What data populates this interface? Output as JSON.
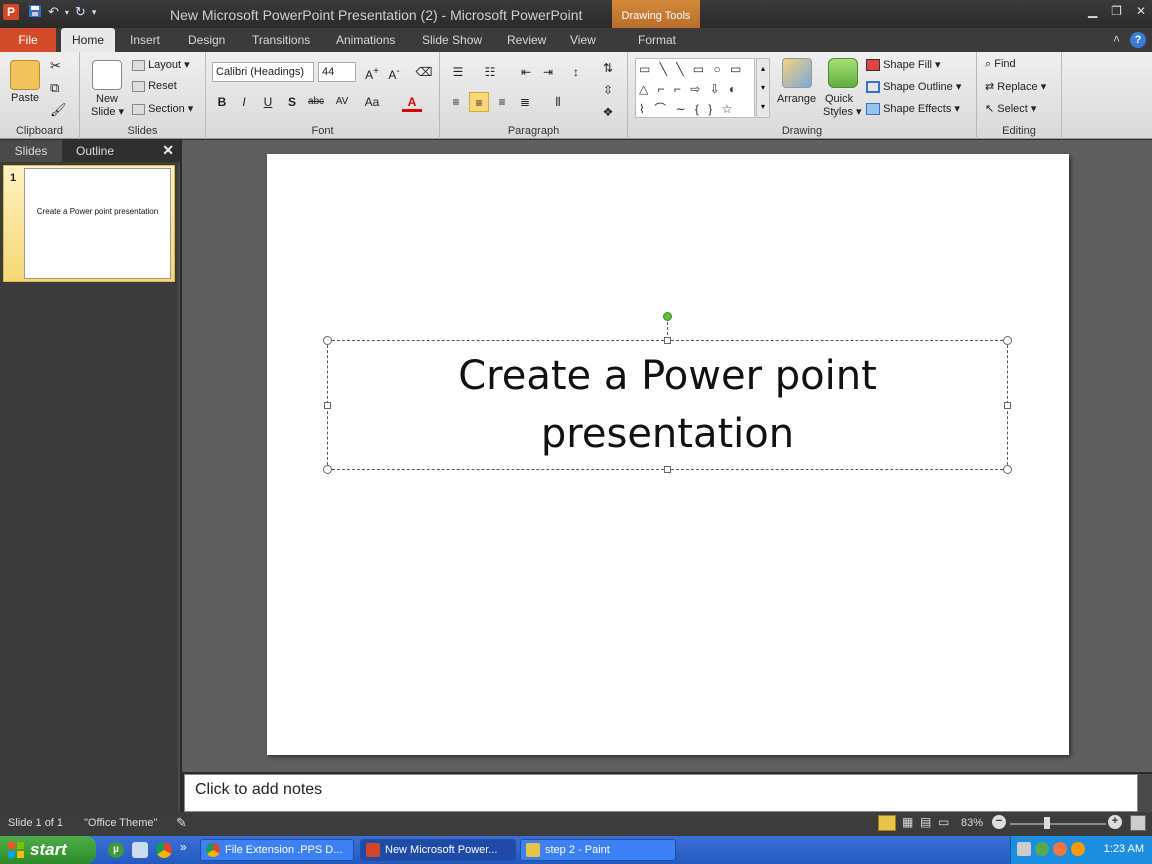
{
  "titlebar": {
    "title": "New Microsoft PowerPoint Presentation (2)  -  Microsoft PowerPoint",
    "contextual_tools": "Drawing Tools",
    "app_icon": "P"
  },
  "tabs": {
    "file": "File",
    "home": "Home",
    "insert": "Insert",
    "design": "Design",
    "transitions": "Transitions",
    "animations": "Animations",
    "slide_show": "Slide Show",
    "review": "Review",
    "view": "View",
    "format": "Format"
  },
  "ribbon": {
    "clipboard": {
      "label": "Clipboard",
      "paste": "Paste"
    },
    "slides": {
      "label": "Slides",
      "new_slide_1": "New",
      "new_slide_2": "Slide ▾",
      "layout": "Layout ▾",
      "reset": "Reset",
      "section": "Section ▾"
    },
    "font": {
      "label": "Font",
      "font_name": "Calibri (Headings)",
      "font_size": "44",
      "bold": "B",
      "italic": "I",
      "underline": "U",
      "shadow": "S",
      "strike": "abc",
      "spacing": "AV",
      "case": "Aa"
    },
    "paragraph": {
      "label": "Paragraph"
    },
    "drawing": {
      "label": "Drawing",
      "arrange": "Arrange",
      "quick_styles_1": "Quick",
      "quick_styles_2": "Styles ▾",
      "shape_fill": "Shape Fill ▾",
      "shape_outline": "Shape Outline ▾",
      "shape_effects": "Shape Effects ▾",
      "shapes_row1": "▭ ╲ ╲ ▭ ○ ▭",
      "shapes_row2": "△ ⌐ ⌐ ⇨ ⇩ ◐",
      "shapes_row3": "⌇ ⌒ ∼ { } ☆"
    },
    "editing": {
      "label": "Editing",
      "find": "Find",
      "replace": "Replace ▾",
      "select": "Select ▾"
    }
  },
  "left_panel": {
    "tab_slides": "Slides",
    "tab_outline": "Outline",
    "close": "✕",
    "thumb_number": "1",
    "thumb_text": "Create a Power point presentation"
  },
  "slide": {
    "title_line1": "Create a Power point",
    "title_line2": "presentation"
  },
  "notes": {
    "placeholder": "Click to add notes"
  },
  "status": {
    "slide_info": "Slide 1 of 1",
    "theme": "\"Office Theme\"",
    "zoom": "83%"
  },
  "taskbar": {
    "start": "start",
    "tasks": [
      {
        "label": "File Extension .PPS D..."
      },
      {
        "label": "New Microsoft Power..."
      },
      {
        "label": "step 2 - Paint"
      }
    ],
    "clock": "1:23 AM"
  },
  "colors": {
    "file_tab": "#d24b2a",
    "context_tab": "#c77a30",
    "taskbar": "#245ac0",
    "start_button": "#3a9a36"
  }
}
